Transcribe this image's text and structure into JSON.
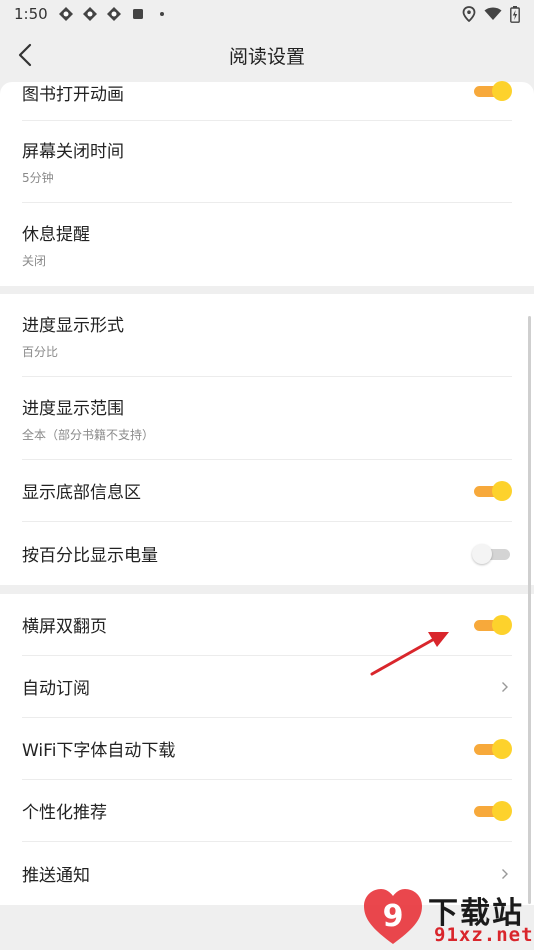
{
  "status_bar": {
    "time": "1:50"
  },
  "header": {
    "title": "阅读设置"
  },
  "sections": [
    {
      "items": [
        {
          "label": "图书打开动画",
          "control": "toggle",
          "state": "on"
        },
        {
          "label": "屏幕关闭时间",
          "sub": "5分钟"
        },
        {
          "label": "休息提醒",
          "sub": "关闭"
        }
      ]
    },
    {
      "items": [
        {
          "label": "进度显示形式",
          "sub": "百分比"
        },
        {
          "label": "进度显示范围",
          "sub": "全本（部分书籍不支持）"
        },
        {
          "label": "显示底部信息区",
          "control": "toggle",
          "state": "on"
        },
        {
          "label": "按百分比显示电量",
          "control": "toggle",
          "state": "off"
        }
      ]
    },
    {
      "items": [
        {
          "label": "横屏双翻页",
          "control": "toggle",
          "state": "on"
        },
        {
          "label": "自动订阅",
          "control": "chevron"
        },
        {
          "label": "WiFi下字体自动下载",
          "control": "toggle",
          "state": "on"
        },
        {
          "label": "个性化推荐",
          "control": "toggle",
          "state": "on"
        },
        {
          "label": "推送通知",
          "control": "chevron"
        }
      ]
    }
  ],
  "watermark": {
    "logo_text": "9",
    "name": "下载站",
    "domain": "91xz.net"
  },
  "colors": {
    "toggle_on_track": "#f7a93b",
    "toggle_on_knob": "#fdd22c",
    "arrow": "#d9262c",
    "background": "#efefef"
  }
}
